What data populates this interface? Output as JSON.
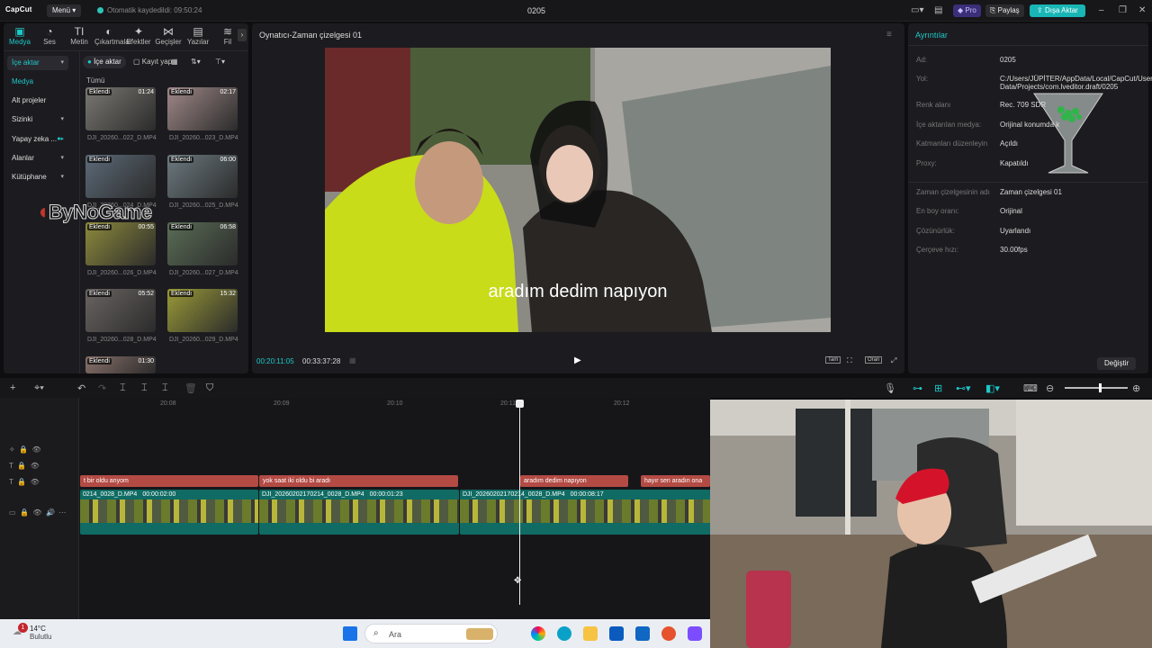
{
  "topbar": {
    "app_name": "CapCut",
    "menu_label": "Menü",
    "autosave": "Otomatik kaydedildi: 09:50:24",
    "project_name": "0205",
    "pro_label": "Pro",
    "share_label": "Paylaş",
    "export_label": "Dışa Aktar"
  },
  "tool_tabs": [
    {
      "label": "Medya",
      "icon": "media-icon"
    },
    {
      "label": "Ses",
      "icon": "audio-icon"
    },
    {
      "label": "Metin",
      "icon": "text-icon"
    },
    {
      "label": "Çıkartmalar",
      "icon": "sticker-icon"
    },
    {
      "label": "Efektler",
      "icon": "effects-icon"
    },
    {
      "label": "Geçişler",
      "icon": "transition-icon"
    },
    {
      "label": "Yazılar",
      "icon": "caption-icon"
    },
    {
      "label": "Fil",
      "icon": "filter-icon"
    }
  ],
  "sidebar": {
    "items": [
      "İçe aktar",
      "Medya",
      "Alt projeler",
      "Sizinki",
      "Yapay zeka ...",
      "Alanlar",
      "Kütüphane"
    ]
  },
  "media": {
    "import_label": "İçe aktar",
    "record_label": "Kayıt yap",
    "all_label": "Tümü",
    "added_badge": "Eklendi",
    "clips": [
      {
        "name": "DJI_20260...022_D.MP4",
        "duration": "01:24"
      },
      {
        "name": "DJI_20260...023_D.MP4",
        "duration": "02:17"
      },
      {
        "name": "DJI_20260...024_D.MP4",
        "duration": ""
      },
      {
        "name": "DJI_20260...025_D.MP4",
        "duration": "06:00"
      },
      {
        "name": "DJI_20260...026_D.MP4",
        "duration": "00:55"
      },
      {
        "name": "DJI_20260...027_D.MP4",
        "duration": "06:58"
      },
      {
        "name": "DJI_20260...028_D.MP4",
        "duration": "05:52"
      },
      {
        "name": "DJI_20260...029_D.MP4",
        "duration": "15:32"
      },
      {
        "name": "",
        "duration": "01:30"
      }
    ]
  },
  "watermark": "ByNoGame",
  "player": {
    "title": "Oynatıcı-Zaman çizelgesi 01",
    "subtitle": "aradım dedim napıyon",
    "current_time": "00:20:11:05",
    "total_time": "00:33:37:28",
    "fit_label": "Tam",
    "ratio_label": "Oran"
  },
  "details": {
    "title": "Ayrıntılar",
    "rows": [
      {
        "label": "Ad:",
        "value": "0205"
      },
      {
        "label": "Yol:",
        "value": "C:/Users/JÜPİTER/AppData/Local/CapCut/User Data/Projects/com.lveditor.draft/0205"
      },
      {
        "label": "Renk alanı",
        "value": "Rec. 709 SDR"
      },
      {
        "label": "İçe aktarılan medya:",
        "value": "Orijinal konumda k"
      },
      {
        "label": "Katmanları düzenleyin",
        "value": "Açıldı"
      },
      {
        "label": "Proxy:",
        "value": "Kapatıldı"
      },
      {
        "label": "Zaman çizelgesinin adı",
        "value": "Zaman çizelgesi 01"
      },
      {
        "label": "En boy oranı:",
        "value": "Orijinal"
      },
      {
        "label": "Çözünürlük:",
        "value": "Uyarlandı"
      },
      {
        "label": "Çerçeve hızı:",
        "value": "30.00fps"
      }
    ],
    "change_label": "Değiştir"
  },
  "timeline": {
    "ruler": [
      "20:08",
      "20:09",
      "20:10",
      "20:11",
      "20:12"
    ],
    "text_clips": [
      "t bir oldu anyom",
      "yok saat iki oldu bi aradı",
      "aradım dedim napıyon",
      "hayır sen aradın ona"
    ],
    "video_clips": [
      {
        "name": "0214_0028_D.MP4",
        "duration": "00:00:02:00"
      },
      {
        "name": "DJI_20260202170214_0028_D.MP4",
        "duration": "00:00:01:23"
      },
      {
        "name": "DJI_20260202170214_0028_D.MP4",
        "duration": "00:00:08:17"
      }
    ]
  },
  "taskbar": {
    "temperature": "14°C",
    "weather": "Bulutlu",
    "notification_count": "1",
    "search_placeholder": "Ara"
  }
}
